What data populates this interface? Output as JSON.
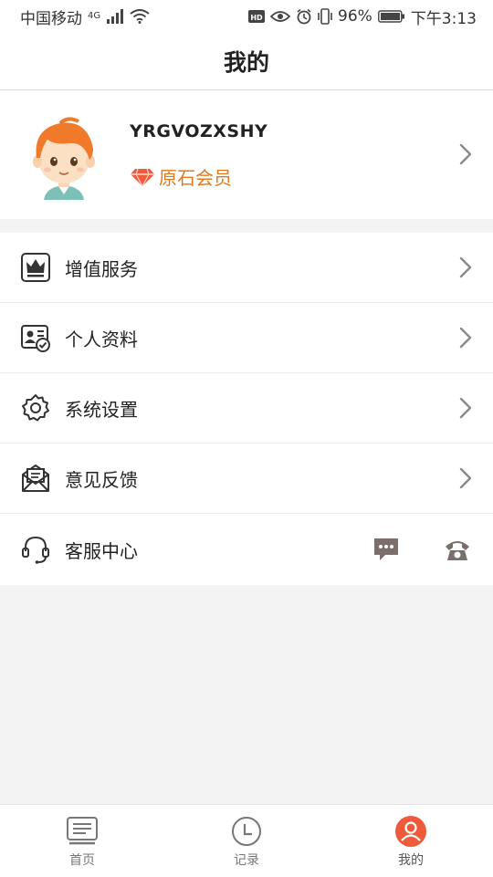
{
  "status": {
    "carrier": "中国移动",
    "network": "4G",
    "battery": "96%",
    "time": "下午3:13"
  },
  "header": {
    "title": "我的"
  },
  "profile": {
    "username": "YRGVOZXSHY",
    "membership": "原石会员"
  },
  "menu": {
    "items": [
      {
        "label": "增值服务",
        "icon": "crown-icon"
      },
      {
        "label": "个人资料",
        "icon": "profile-card-icon"
      },
      {
        "label": "系统设置",
        "icon": "gear-icon"
      },
      {
        "label": "意见反馈",
        "icon": "mail-icon"
      },
      {
        "label": "客服中心",
        "icon": "headset-icon"
      }
    ]
  },
  "tabs": [
    {
      "label": "首页",
      "icon": "home-icon"
    },
    {
      "label": "记录",
      "icon": "clock-icon"
    },
    {
      "label": "我的",
      "icon": "user-icon",
      "active": true
    }
  ],
  "colors": {
    "accent": "#ee5a3a",
    "member": "#e07a1f"
  }
}
